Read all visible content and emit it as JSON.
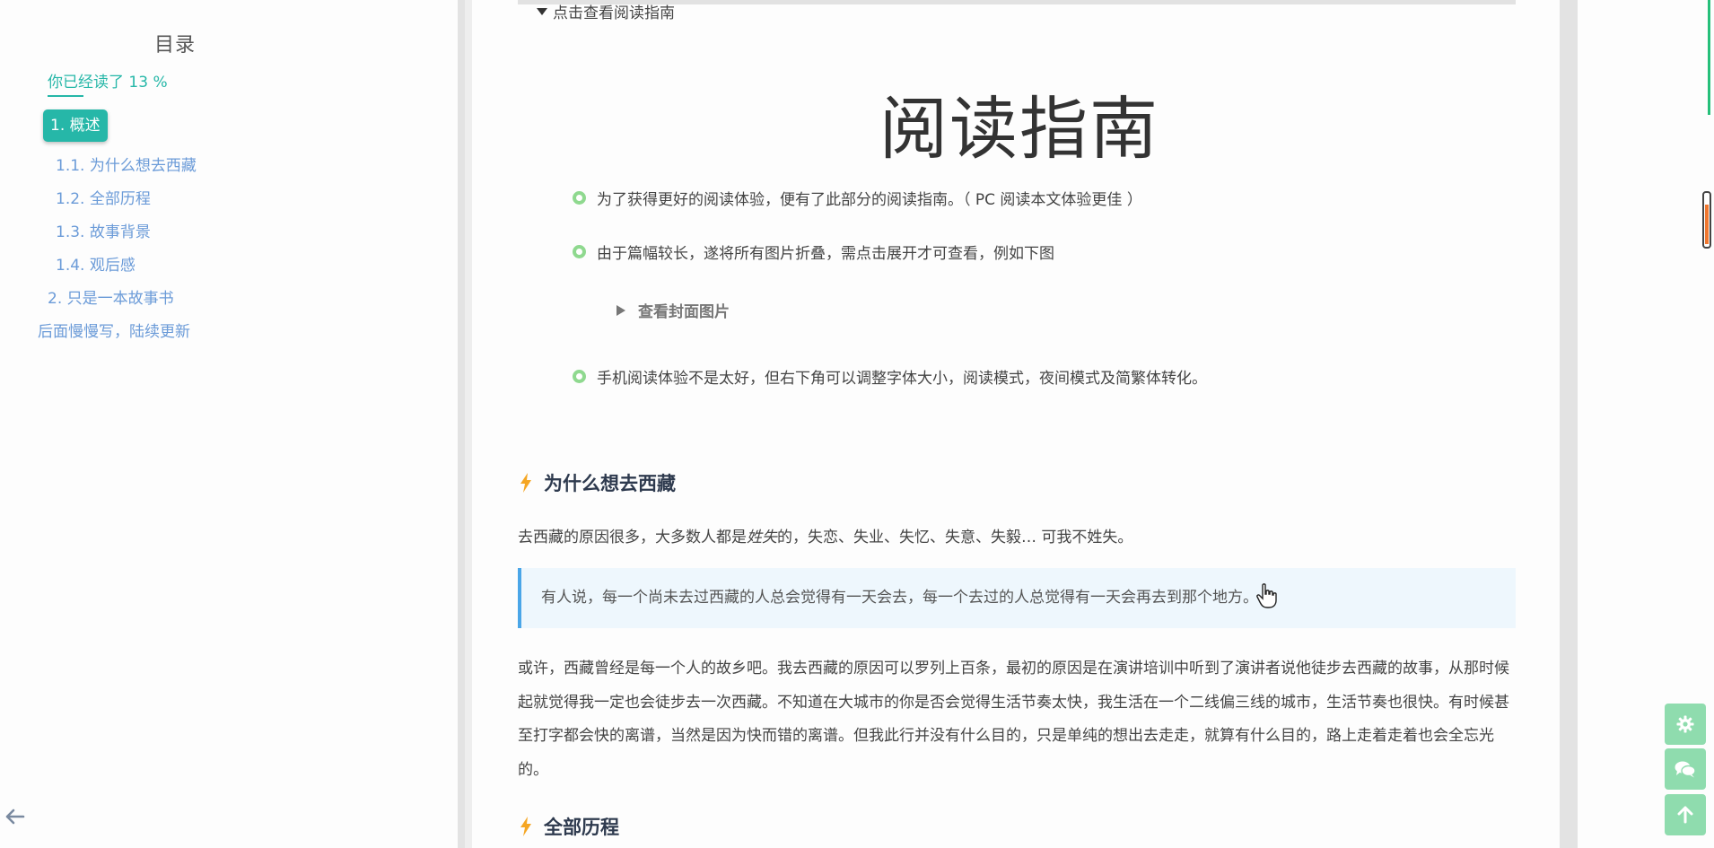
{
  "toc": {
    "title": "目录",
    "progress": "你已经读了  13 %",
    "active_item": "1. 概述",
    "items": [
      "1.1. 为什么想去西藏",
      "1.2. 全部历程",
      "1.3. 故事背景",
      "1.4. 观后感",
      "2. 只是一本故事书",
      "后面慢慢写，陆续更新"
    ]
  },
  "content": {
    "details_summary": "点击查看阅读指南",
    "guide_title": "阅读指南",
    "bullets": [
      "为了获得更好的阅读体验，便有了此部分的阅读指南。（ PC 阅读本文体验更佳 ）",
      "由于篇幅较长，遂将所有图片折叠，需点击展开才可查看，例如下图",
      "手机阅读体验不是太好，但右下角可以调整字体大小，阅读模式，夜间模式及简繁体转化。"
    ],
    "fold_label": "查看封面图片",
    "section1": {
      "heading": "为什么想去西藏",
      "intro_prefix": "去西藏的原因很多，大多数人都是",
      "intro_em": "姓失",
      "intro_suffix": "的，失恋、失业、失忆、失意、失毅… 可我不姓失。",
      "quote": "有人说，每一个尚未去过西藏的人总会觉得有一天会去，每一个去过的人总觉得有一天会再去到那个地方。",
      "paragraph": "或许，西藏曾经是每一个人的故乡吧。我去西藏的原因可以罗列上百条，最初的原因是在演讲培训中听到了演讲者说他徒步去西藏的故事，从那时候起就觉得我一定也会徒步去一次西藏。不知道在大城市的你是否会觉得生活节奏太快，我生活在一个二线偏三线的城市，生活节奏也很快。有时候甚至打字都会快的离谱，当然是因为快而错的离谱。但我此行并没有什么目的，只是单纯的想出去走走，就算有什么目的，路上走着走着也会全忘光的。"
    },
    "section2": {
      "heading": "全部历程"
    }
  },
  "icons": {
    "bolt": "bolt-icon",
    "back": "arrow-left-icon",
    "settings": "gear-icon",
    "comments": "comments-icon",
    "top": "arrow-up-icon"
  },
  "colors": {
    "accent": "#26b7a8",
    "link": "#6b9bd8",
    "bullet": "#8fd98f",
    "bolt": "#f5a623",
    "fab": "#8fdcae",
    "quote_border": "#4aa6e8"
  }
}
